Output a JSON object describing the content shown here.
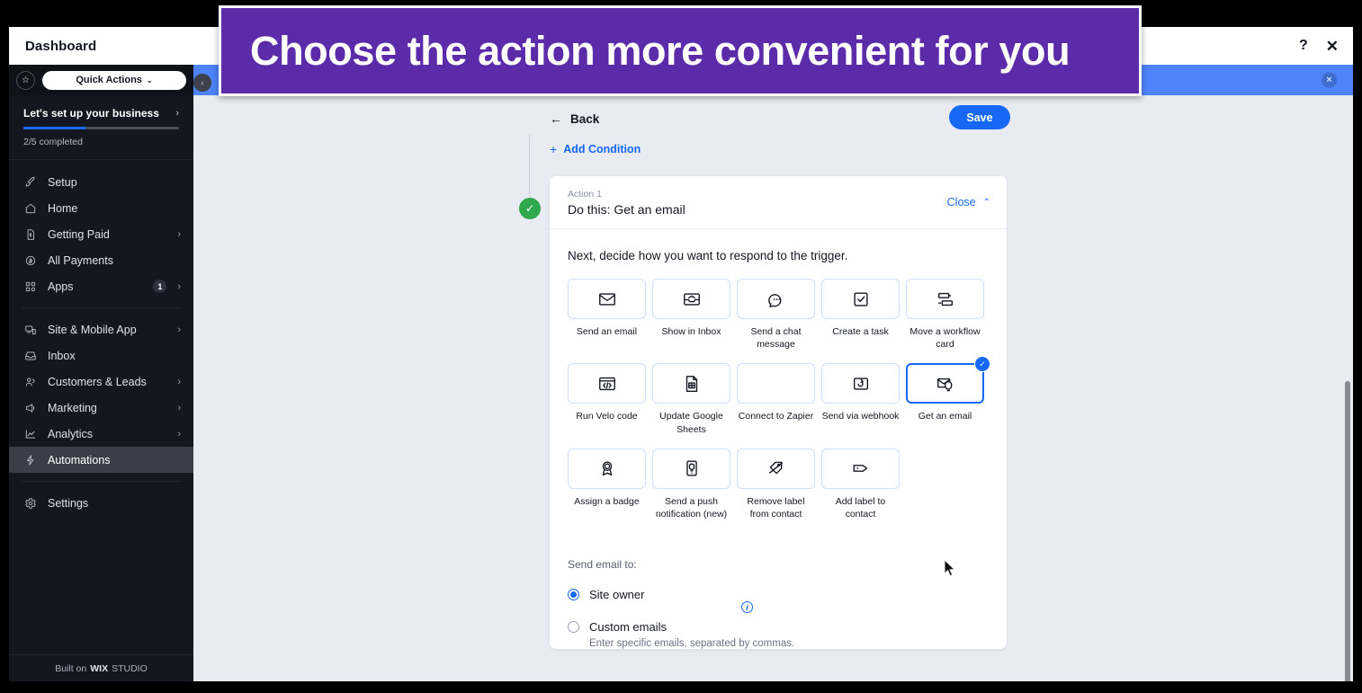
{
  "window": {
    "title": "Dashboard",
    "help_icon": "?",
    "close_icon": "✕"
  },
  "notification_bar": {
    "close_icon": "✕"
  },
  "sidebar": {
    "star_icon": "☆",
    "quick_actions_label": "Quick Actions",
    "quick_actions_caret": "⌄",
    "setup": {
      "title": "Let's set up your business",
      "chevron": "›",
      "progress_percent": 40,
      "progress_label": "2/5 completed"
    },
    "items": [
      {
        "label": "Setup",
        "icon": "rocket-icon",
        "chevron": "",
        "badge": ""
      },
      {
        "label": "Home",
        "icon": "home-icon",
        "chevron": "",
        "badge": ""
      },
      {
        "label": "Getting Paid",
        "icon": "invoice-icon",
        "chevron": "›",
        "badge": ""
      },
      {
        "label": "All Payments",
        "icon": "dollar-circle-icon",
        "chevron": "",
        "badge": ""
      },
      {
        "label": "Apps",
        "icon": "apps-icon",
        "chevron": "›",
        "badge": "1"
      },
      {
        "label": "Site & Mobile App",
        "icon": "devices-icon",
        "chevron": "›",
        "badge": ""
      },
      {
        "label": "Inbox",
        "icon": "inbox-icon",
        "chevron": "",
        "badge": ""
      },
      {
        "label": "Customers & Leads",
        "icon": "people-icon",
        "chevron": "›",
        "badge": ""
      },
      {
        "label": "Marketing",
        "icon": "megaphone-icon",
        "chevron": "›",
        "badge": ""
      },
      {
        "label": "Analytics",
        "icon": "chart-icon",
        "chevron": "›",
        "badge": ""
      },
      {
        "label": "Automations",
        "icon": "bolt-icon",
        "chevron": "",
        "badge": ""
      },
      {
        "label": "Settings",
        "icon": "gear-icon",
        "chevron": "",
        "badge": ""
      }
    ],
    "active_item": "Automations",
    "collapse_icon": "‹",
    "footer": {
      "prefix": "Built on",
      "brand": "WIX",
      "brand_suffix": "STUDIO"
    }
  },
  "editor": {
    "back_label": "Back",
    "back_arrow": "←",
    "save_label": "Save",
    "add_condition_label": "Add Condition",
    "add_condition_plus": "+",
    "step_check_icon": "✓"
  },
  "action_card": {
    "kicker": "Action 1",
    "title": "Do this: Get an email",
    "close_label": "Close",
    "close_chevron": "⌃",
    "prompt": "Next, decide how you want to respond to the trigger.",
    "selected_tile": "Get an email",
    "selected_check_icon": "✓",
    "tiles": [
      {
        "label": "Send an email",
        "icon": "envelope-icon"
      },
      {
        "label": "Show in Inbox",
        "icon": "inbox-tray-icon"
      },
      {
        "label": "Send a chat message",
        "icon": "chat-bubble-icon"
      },
      {
        "label": "Create a task",
        "icon": "checkbox-icon"
      },
      {
        "label": "Move a workflow card",
        "icon": "workflow-cards-icon"
      },
      {
        "label": "Run Velo code",
        "icon": "code-window-icon"
      },
      {
        "label": "Update Google Sheets",
        "icon": "spreadsheet-icon"
      },
      {
        "label": "Connect to Zapier",
        "icon": "gear-icon"
      },
      {
        "label": "Send via webhook",
        "icon": "webhook-icon"
      },
      {
        "label": "Get an email",
        "icon": "envelope-bell-icon"
      },
      {
        "label": "Assign a badge",
        "icon": "badge-icon"
      },
      {
        "label": "Send a push notification (new)",
        "icon": "phone-bell-icon"
      },
      {
        "label": "Remove label from contact",
        "icon": "tag-slash-icon"
      },
      {
        "label": "Add label to contact",
        "icon": "tag-icon"
      }
    ],
    "send_email_to_label": "Send email to:",
    "info_icon": "i",
    "options": [
      {
        "title": "Site owner",
        "subtitle": "",
        "selected": true
      },
      {
        "title": "Custom emails",
        "subtitle": "Enter specific emails, separated by commas.",
        "selected": false
      }
    ]
  },
  "overlay": {
    "text": "Choose the action more convenient for you",
    "background_color": "#5B2BA9",
    "text_color": "#FFFFFF"
  },
  "colors": {
    "accent_blue": "#1668F5",
    "notification_blue": "#4D84FB",
    "sidebar_dark": "#14171F",
    "canvas_bg": "#E8EBF2",
    "success_green": "#2FA84F",
    "overlay_purple": "#5B2BA9"
  }
}
